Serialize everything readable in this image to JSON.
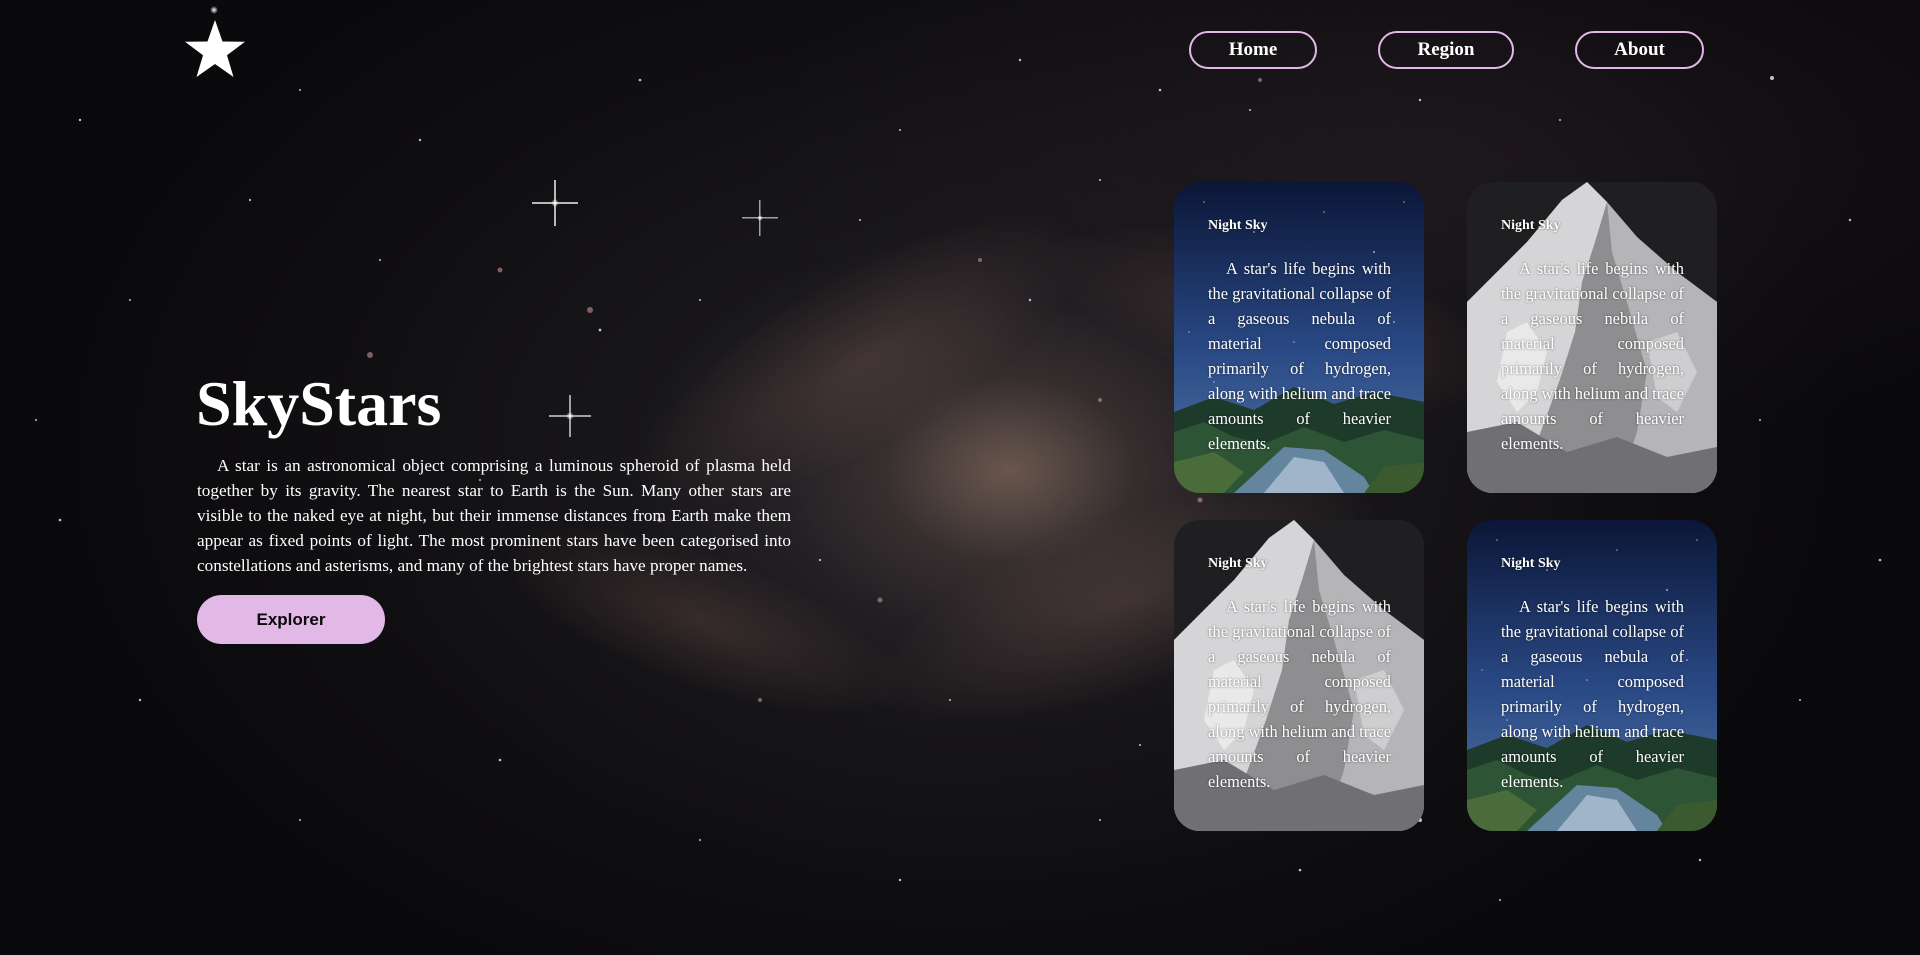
{
  "brand": {
    "logo_icon": "star-icon"
  },
  "nav": {
    "items": [
      {
        "label": "Home"
      },
      {
        "label": "Region"
      },
      {
        "label": "About"
      }
    ],
    "accent": "#e2b8e6"
  },
  "hero": {
    "title": "SkyStars",
    "text": "A star is an astronomical object comprising a luminous spheroid of plasma held together by its gravity. The nearest star to Earth is the Sun. Many other stars are visible to the naked eye at night, but their immense distances from Earth make them appear as fixed points of light. The most prominent stars have been categorised into constellations and asterisms, and many of the brightest stars have proper names.",
    "button_label": "Explorer",
    "button_color": "#e2b8e6"
  },
  "cards": [
    {
      "title": "Night Sky",
      "text": "A star's life begins with the gravitational collapse of a gaseous nebula of material composed primarily of hydrogen, along with helium and trace amounts of heavier elements.",
      "image": "night-sky-waterfall"
    },
    {
      "title": "Night Sky",
      "text": "A star's life begins with the gravitational collapse of a gaseous nebula of material composed primarily of hydrogen, along with helium and trace amounts of heavier elements.",
      "image": "snowy-mountain"
    },
    {
      "title": "Night Sky",
      "text": "A star's life begins with the gravitational collapse of a gaseous nebula of material composed primarily of hydrogen, along with helium and trace amounts of heavier elements.",
      "image": "snowy-mountain"
    },
    {
      "title": "Night Sky",
      "text": "A star's life begins with the gravitational collapse of a gaseous nebula of material composed primarily of hydrogen, along with helium and trace amounts of heavier elements.",
      "image": "night-sky-waterfall"
    }
  ]
}
